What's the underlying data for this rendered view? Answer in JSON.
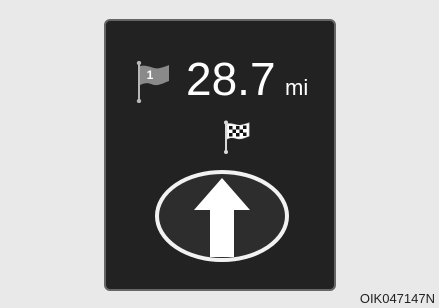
{
  "navigation": {
    "waypoint_number": "1",
    "distance_value": "28.7",
    "distance_unit": "mi",
    "waypoint_icon": "waypoint-flag-icon",
    "destination_icon": "checkered-flag-icon",
    "direction_icon": "straight-arrow-icon"
  },
  "caption": {
    "figure_code": "OIK047147N"
  },
  "colors": {
    "display_background": "#222222",
    "text": "#ffffff",
    "flag_gray": "#8a8a8a",
    "page_background": "#e9e9e9"
  }
}
